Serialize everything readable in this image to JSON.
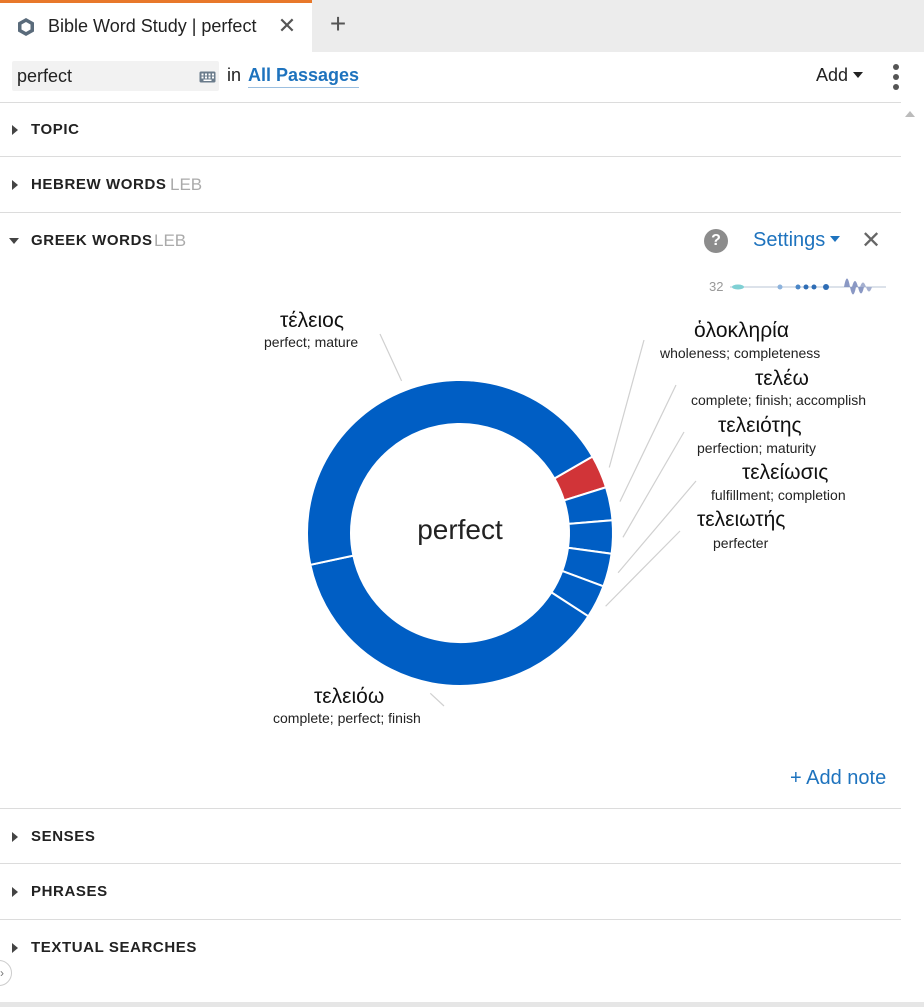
{
  "tab": {
    "title": "Bible Word Study | perfect",
    "close_glyph": "✕",
    "new_glyph": "+"
  },
  "search": {
    "value": "perfect",
    "in_label": "in",
    "scope_link": "All Passages"
  },
  "toolbar": {
    "add_label": "Add"
  },
  "sections": {
    "topic": {
      "title": "TOPIC"
    },
    "hebrew": {
      "title": "HEBREW WORDS",
      "sub": "LEB"
    },
    "greek": {
      "title": "GREEK WORDS",
      "sub": "LEB"
    },
    "senses": {
      "title": "SENSES"
    },
    "phrases": {
      "title": "PHRASES"
    },
    "textual": {
      "title": "TEXTUAL SEARCHES"
    }
  },
  "greek_panel": {
    "help_glyph": "?",
    "settings_label": "Settings",
    "close_glyph": "✕",
    "timeline_count": "32",
    "add_note": "+ Add note"
  },
  "chart_data": {
    "type": "pie",
    "center_label": "perfect",
    "slices": [
      {
        "lemma": "ὁλοκληρία",
        "gloss": "wholeness; completeness",
        "share": 0.035,
        "color": "#d13438"
      },
      {
        "lemma": "τελέω",
        "gloss": "complete; finish; accomplish",
        "share": 0.035,
        "color": "#005ec4"
      },
      {
        "lemma": "τελειότης",
        "gloss": "perfection; maturity",
        "share": 0.035,
        "color": "#005ec4"
      },
      {
        "lemma": "τελείωσις",
        "gloss": "fulfillment; completion",
        "share": 0.035,
        "color": "#005ec4"
      },
      {
        "lemma": "τελειωτής",
        "gloss": "perfecter",
        "share": 0.035,
        "color": "#005ec4"
      },
      {
        "lemma": "τελειόω",
        "gloss": "complete; perfect; finish",
        "share": 0.375,
        "color": "#005ec4"
      },
      {
        "lemma": "τέλειος",
        "gloss": "perfect; mature",
        "share": 0.45,
        "color": "#005ec4"
      }
    ]
  }
}
